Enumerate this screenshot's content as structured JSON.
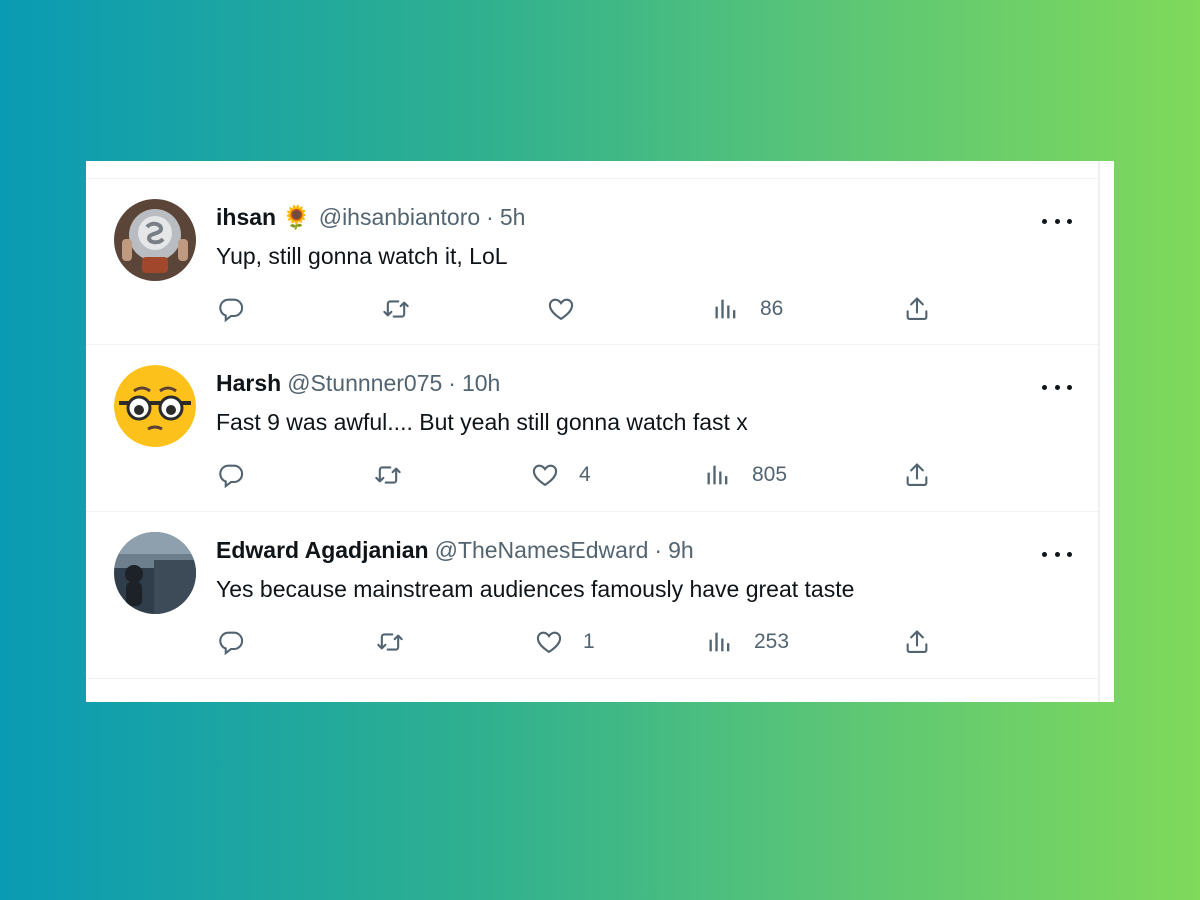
{
  "tweets": [
    {
      "name": "ihsan",
      "emoji": "🌻",
      "handle": "@ihsanbiantoro",
      "separator": "·",
      "time": "5h",
      "text": "Yup, still gonna watch it, LoL",
      "likes": "",
      "views": "86"
    },
    {
      "name": "Harsh",
      "emoji": "",
      "handle": "@Stunnner075",
      "separator": "·",
      "time": "10h",
      "text": "Fast 9 was awful.... But yeah still gonna watch fast x",
      "likes": "4",
      "views": "805"
    },
    {
      "name": "Edward Agadjanian",
      "emoji": "",
      "handle": "@TheNamesEdward",
      "separator": "·",
      "time": "9h",
      "text": "Yes because mainstream audiences famously have great taste",
      "likes": "1",
      "views": "253"
    }
  ],
  "icons": {
    "reply": "reply-icon",
    "retweet": "retweet-icon",
    "like": "like-icon",
    "views": "views-icon",
    "share": "share-icon",
    "more": "more-icon"
  },
  "colors": {
    "text_primary": "#0f1419",
    "text_secondary": "#536471",
    "gradient_start": "#0a9bb4",
    "gradient_end": "#7fd95a"
  }
}
